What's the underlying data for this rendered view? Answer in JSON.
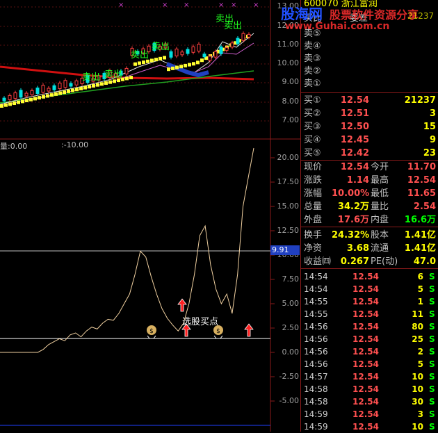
{
  "header": {
    "stock_code": "600070",
    "stock_name": "浙江富润",
    "watermark_logo": "股海网",
    "watermark_text": "股票软件资源分享",
    "watermark_url": "www.Guhai.com.cn",
    "fragment_right": "21237"
  },
  "top_chart": {
    "price_ticks": [
      "13.00",
      "12.00",
      "11.00",
      "10.00",
      "9.00",
      "8.00",
      "7.00"
    ],
    "sell_labels": [
      "卖出",
      "卖出",
      "卖出",
      "卖出",
      "卖出",
      "卖出"
    ],
    "markers": [
      "×",
      "×",
      "×",
      "×",
      "×",
      "×"
    ]
  },
  "indicator": {
    "header_left": "量:0.00",
    "header_mid": ":-10.00",
    "ticks": [
      "20.00",
      "17.50",
      "15.00",
      "12.50",
      "10.00",
      "7.50",
      "5.00",
      "2.50",
      "0.00",
      "-2.50",
      "-5.00"
    ],
    "current_value_label": "9.91",
    "annotation": "选股买点"
  },
  "chart_data": {
    "type": "line",
    "title": "",
    "ylim": [
      -7.5,
      21
    ],
    "x": [
      0,
      1,
      2,
      3,
      4,
      5,
      6,
      7,
      8,
      9,
      10,
      11,
      12,
      13,
      14,
      15,
      16,
      17,
      18,
      19,
      20,
      21,
      22,
      23,
      24,
      25,
      26,
      27,
      28,
      29,
      30,
      31,
      32,
      33,
      34,
      35,
      36,
      37,
      38,
      39,
      40,
      41,
      42,
      43,
      44,
      45,
      46,
      47
    ],
    "series": [
      {
        "values": [
          0,
          0,
          0,
          0,
          0,
          0,
          0,
          0,
          0.3,
          0.8,
          1.1,
          1.4,
          1.2,
          1.8,
          2.0,
          1.6,
          2.2,
          2.6,
          2.4,
          3.0,
          3.4,
          3.3,
          4.0,
          5.0,
          6.0,
          8.0,
          10.4,
          9.8,
          7.8,
          6.0,
          4.5,
          3.5,
          2.8,
          2.2,
          3.0,
          5.0,
          8.0,
          12.0,
          13.0,
          9.0,
          6.5,
          5.0,
          6.0,
          4.0,
          8.0,
          15.0,
          18.0,
          21.0
        ]
      }
    ]
  },
  "order_book": {
    "partial_row": {
      "label": "买比",
      "value_label": "委差"
    },
    "sell": [
      {
        "label": "卖⑤"
      },
      {
        "label": "卖④"
      },
      {
        "label": "卖③"
      },
      {
        "label": "卖②"
      },
      {
        "label": "卖①"
      }
    ],
    "buy": [
      {
        "label": "买①",
        "price": "12.54",
        "vol": "21237"
      },
      {
        "label": "买②",
        "price": "12.51",
        "vol": "3"
      },
      {
        "label": "买③",
        "price": "12.50",
        "vol": "15"
      },
      {
        "label": "买④",
        "price": "12.45",
        "vol": "9"
      },
      {
        "label": "买⑤",
        "price": "12.42",
        "vol": "23"
      }
    ]
  },
  "stats": [
    {
      "l1": "现价",
      "v1": "12.54",
      "l2": "今开",
      "v2": "11.70",
      "c1": "#ff5050",
      "c2": "#ff5050"
    },
    {
      "l1": "涨跌",
      "v1": "1.14",
      "l2": "最高",
      "v2": "12.54",
      "c1": "#ff5050",
      "c2": "#ff5050"
    },
    {
      "l1": "涨幅",
      "v1": "10.00%",
      "l2": "最低",
      "v2": "11.65",
      "c1": "#ff5050",
      "c2": "#ff5050"
    },
    {
      "l1": "总量",
      "v1": "34.2万",
      "l2": "量比",
      "v2": "2.54",
      "c1": "#ffff00",
      "c2": "#ff5050"
    },
    {
      "l1": "外盘",
      "v1": "17.6万",
      "l2": "内盘",
      "v2": "16.6万",
      "c1": "#ff5050",
      "c2": "#00ff00"
    },
    {
      "l1": "换手",
      "v1": "24.32%",
      "l2": "股本",
      "v2": "1.41亿",
      "c1": "#ffff00",
      "c2": "#ffff00"
    },
    {
      "l1": "净资",
      "v1": "3.68",
      "l2": "流通",
      "v2": "1.41亿",
      "c1": "#ffff00",
      "c2": "#ffff00"
    },
    {
      "l1": "收益㈣",
      "v1": "0.267",
      "l2": "PE(动)",
      "v2": "47.0",
      "c1": "#ffff00",
      "c2": "#ffff00"
    }
  ],
  "ticks": [
    {
      "time": "14:54",
      "price": "12.54",
      "vol": "6",
      "dir": "S"
    },
    {
      "time": "14:54",
      "price": "12.54",
      "vol": "5",
      "dir": "S"
    },
    {
      "time": "14:55",
      "price": "12.54",
      "vol": "1",
      "dir": "S"
    },
    {
      "time": "14:55",
      "price": "12.54",
      "vol": "11",
      "dir": "S"
    },
    {
      "time": "14:56",
      "price": "12.54",
      "vol": "80",
      "dir": "S"
    },
    {
      "time": "14:56",
      "price": "12.54",
      "vol": "25",
      "dir": "S"
    },
    {
      "time": "14:56",
      "price": "12.54",
      "vol": "2",
      "dir": "S"
    },
    {
      "time": "14:56",
      "price": "12.54",
      "vol": "5",
      "dir": "S"
    },
    {
      "time": "14:57",
      "price": "12.54",
      "vol": "10",
      "dir": "S"
    },
    {
      "time": "14:58",
      "price": "12.54",
      "vol": "10",
      "dir": "S"
    },
    {
      "time": "14:58",
      "price": "12.54",
      "vol": "30",
      "dir": "S"
    },
    {
      "time": "14:59",
      "price": "12.54",
      "vol": "3",
      "dir": "S"
    },
    {
      "time": "14:59",
      "price": "12.54",
      "vol": "10",
      "dir": "S"
    }
  ]
}
